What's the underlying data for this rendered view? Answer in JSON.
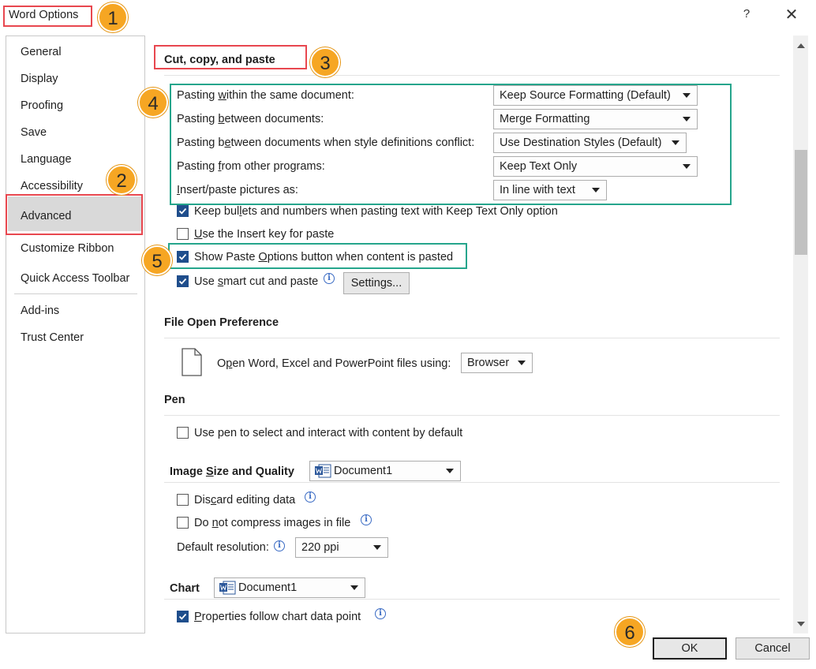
{
  "window": {
    "title": "Word Options",
    "help_glyph": "?",
    "close_glyph": "✕"
  },
  "sidebar": {
    "items": [
      {
        "label": "General"
      },
      {
        "label": "Display"
      },
      {
        "label": "Proofing"
      },
      {
        "label": "Save"
      },
      {
        "label": "Language"
      },
      {
        "label": "Accessibility"
      },
      {
        "label": "Advanced",
        "selected": true
      },
      {
        "label": "Customize Ribbon"
      },
      {
        "label": "Quick Access Toolbar"
      },
      {
        "label": "Add-ins"
      },
      {
        "label": "Trust Center"
      }
    ]
  },
  "cut_copy_paste": {
    "title": "Cut, copy, and paste",
    "rows": [
      {
        "pre": "Pasting ",
        "ul": "w",
        "post": "ithin the same document:",
        "value": "Keep Source Formatting (Default)"
      },
      {
        "pre": "Pasting ",
        "ul": "b",
        "post": "etween documents:",
        "value": "Merge Formatting"
      },
      {
        "pre": "Pasting b",
        "ul": "e",
        "post": "tween documents when style definitions conflict:",
        "value": "Use Destination Styles (Default)"
      },
      {
        "pre": "Pasting ",
        "ul": "f",
        "post": "rom other programs:",
        "value": "Keep Text Only"
      },
      {
        "pre": "",
        "ul": "I",
        "post": "nsert/paste pictures as:",
        "value": "In line with text"
      }
    ],
    "checks": [
      {
        "pre": "Keep bul",
        "ul": "l",
        "post": "ets and numbers when pasting text with Keep Text Only option",
        "checked": true
      },
      {
        "pre": "",
        "ul": "U",
        "post": "se the Insert key for paste",
        "checked": false
      },
      {
        "pre": "Show Paste ",
        "ul": "O",
        "post": "ptions button when content is pasted",
        "checked": true
      },
      {
        "pre": "Use ",
        "ul": "s",
        "post": "mart cut and paste",
        "checked": true
      }
    ],
    "settings_pre": "Settin",
    "settings_ul": "g",
    "settings_post": "s..."
  },
  "file_open": {
    "title": "File Open Preference",
    "label_pre": "O",
    "label_ul": "p",
    "label_post": "en Word, Excel and PowerPoint files using:",
    "value": "Browser"
  },
  "pen": {
    "title": "Pen",
    "check_label": "Use pen to select and interact with content by default",
    "checked": false
  },
  "image_quality": {
    "title_pre": "Image ",
    "title_ul": "S",
    "title_post": "ize and Quality",
    "document": "Document1",
    "discard_pre": "Dis",
    "discard_ul": "c",
    "discard_post": "ard editing data",
    "compress_pre": "Do ",
    "compress_ul": "n",
    "compress_post": "ot compress images in file",
    "resolution_pre": "Default resolution:",
    "resolution_ul": "",
    "resolution_value": "220 ppi"
  },
  "chart": {
    "title": "Chart",
    "document": "Document1",
    "check_pre": "",
    "check_ul": "P",
    "check_post": "roperties follow chart data point",
    "checked": true
  },
  "footer": {
    "ok": "OK",
    "cancel": "Cancel"
  },
  "badges": [
    "1",
    "2",
    "3",
    "4",
    "5",
    "6"
  ],
  "colors": {
    "accent_check": "#1f4e8c",
    "badge": "#f6a623",
    "red_highlight": "#e8474f",
    "green_highlight": "#26a58c"
  }
}
